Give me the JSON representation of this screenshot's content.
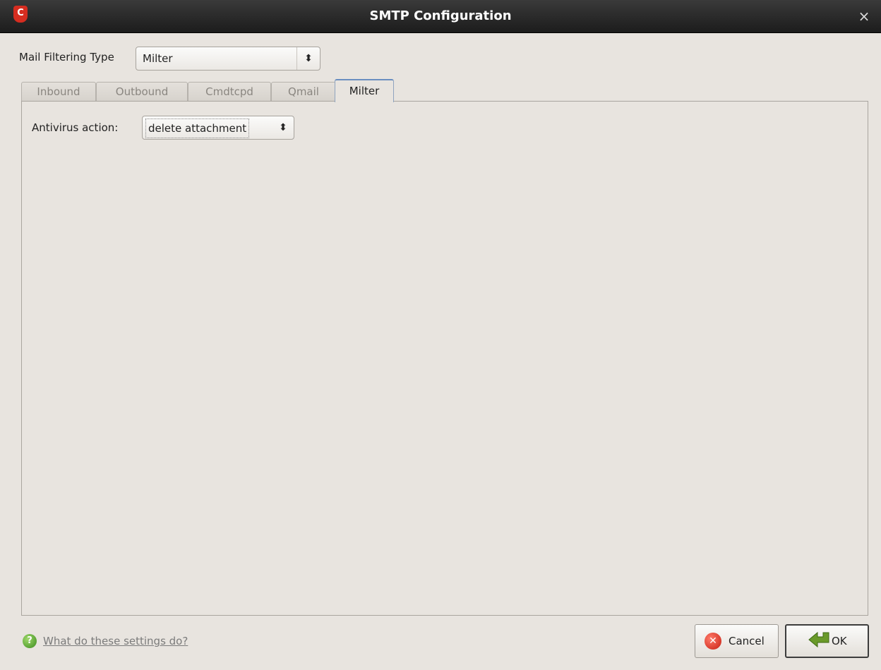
{
  "window": {
    "title": "SMTP Configuration",
    "app_icon_letter": "C",
    "close_glyph": "×"
  },
  "mail_filtering": {
    "label": "Mail Filtering Type",
    "value": "Milter",
    "arrows": "⬍"
  },
  "tabs": [
    {
      "label": "Inbound",
      "active": false
    },
    {
      "label": "Outbound",
      "active": false
    },
    {
      "label": "Cmdtcpd",
      "active": false
    },
    {
      "label": "Qmail",
      "active": false
    },
    {
      "label": "Milter",
      "active": true
    }
  ],
  "milter": {
    "antivirus_label": "Antivirus action:",
    "antivirus_value": "delete attachment",
    "arrows": "⬍"
  },
  "footer": {
    "help_icon": "?",
    "help_link": "What do these settings do?",
    "cancel_label": "Cancel",
    "cancel_icon": "✕",
    "ok_label": "OK"
  },
  "colors": {
    "titlebar": "#1c1c1c",
    "window_bg": "#e8e4df",
    "active_tab_border": "#6a8ec0",
    "help_icon": "#3b8b1d",
    "cancel_icon": "#c71d10",
    "ok_icon": "#6a9a2a"
  }
}
